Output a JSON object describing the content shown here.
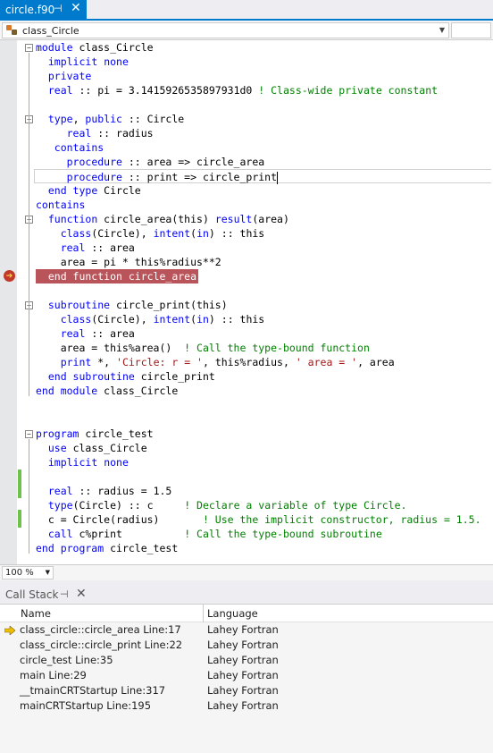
{
  "document_tab": {
    "title": "circle.f90"
  },
  "navigation": {
    "scope": "class_Circle"
  },
  "code_lines": [
    "<k>module</k> class_Circle",
    "  <k>implicit</k> <k>none</k>",
    "  <k>private</k>",
    "  <k>real</k> :: pi = 3.1415926535897931d0 <c>! Class-wide private constant</c>",
    "",
    "  <k>type</k>, <k>public</k> :: Circle",
    "     <k>real</k> :: radius",
    "   <k>contains</k>",
    "     <k>procedure</k> :: area => circle_area",
    "     <k>procedure</k> :: print => circle_print",
    "  <k>end type</k> Circle",
    "<k>contains</k>",
    "  <k>function</k> circle_area(this) <k>result</k>(area)",
    "    <k>class</k>(Circle), <k>intent</k>(<k>in</k>) :: this",
    "    <k>real</k> :: area",
    "    area = pi * this%radius**2",
    "  end function circle_area",
    "",
    "  <k>subroutine</k> circle_print(this)",
    "    <k>class</k>(Circle), <k>intent</k>(<k>in</k>) :: this",
    "    <k>real</k> :: area",
    "    area = this%area()  <c>! Call the type-bound function</c>",
    "    <k>print</k> *, <s>'Circle: r = '</s>, this%radius, <s>' area = '</s>, area",
    "  <k>end subroutine</k> circle_print",
    "<k>end module</k> class_Circle",
    "",
    "",
    "<k>program</k> circle_test",
    "  <k>use</k> class_Circle",
    "  <k>implicit</k> <k>none</k>",
    "",
    "  <k>real</k> :: radius = 1.5",
    "  <k>type</k>(Circle) :: c     <c>! Declare a variable of type Circle.</c>",
    "  c = Circle(radius)       <c>! Use the implicit constructor, radius = 1.5.</c>",
    "  <k>call</k> c%print          <c>! Call the type-bound subroutine</c>",
    "<k>end program</k> circle_test"
  ],
  "zoom": {
    "level": "100 %"
  },
  "call_stack": {
    "title": "Call Stack",
    "columns": {
      "name": "Name",
      "language": "Language"
    },
    "rows": [
      {
        "name": "class_circle::circle_area Line:17",
        "language": "Lahey Fortran"
      },
      {
        "name": "class_circle::circle_print Line:22",
        "language": "Lahey Fortran"
      },
      {
        "name": "circle_test Line:35",
        "language": "Lahey Fortran"
      },
      {
        "name": "main Line:29",
        "language": "Lahey Fortran"
      },
      {
        "name": "__tmainCRTStartup Line:317",
        "language": "Lahey Fortran"
      },
      {
        "name": "mainCRTStartup Line:195",
        "language": "Lahey Fortran"
      }
    ]
  },
  "colors": {
    "accent": "#007acc",
    "keyword": "#0000ff",
    "comment": "#008000",
    "string": "#a31515",
    "breakpoint_line": "#b9545a",
    "changed_bar": "#6cc24a"
  },
  "icons": {
    "class": "class-icon",
    "breakpoint": "current-statement-arrow-icon"
  }
}
